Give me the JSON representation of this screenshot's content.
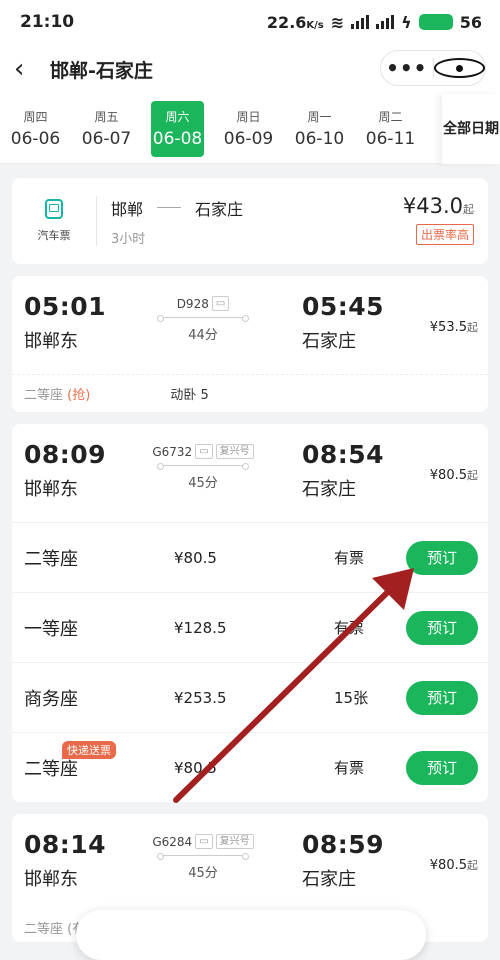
{
  "status": {
    "time": "21:10",
    "speed": "22.6",
    "speed_unit": "K/s",
    "battery": "56"
  },
  "nav": {
    "title": "邯郸-石家庄",
    "back_icon": "chevron-left-icon",
    "more_icon": "more-dots-icon",
    "close_icon": "target-icon"
  },
  "dates": [
    {
      "weekday": "周四",
      "date": "06-06"
    },
    {
      "weekday": "周五",
      "date": "06-07"
    },
    {
      "weekday": "周六",
      "date": "06-08"
    },
    {
      "weekday": "周日",
      "date": "06-09"
    },
    {
      "weekday": "周一",
      "date": "06-10"
    },
    {
      "weekday": "周二",
      "date": "06-11"
    }
  ],
  "all_dates": "全部日期",
  "bus": {
    "type": "汽车票",
    "from": "邯郸",
    "to": "石家庄",
    "duration": "3小时",
    "price": "¥43.0",
    "price_suffix": "起",
    "badge": "出票率高"
  },
  "trains": [
    {
      "dep_time": "05:01",
      "dep_station": "邯郸东",
      "train_no": "D928",
      "duration": "44分",
      "arr_time": "05:45",
      "arr_station": "石家庄",
      "price": "¥53.5",
      "price_suffix": "起",
      "seat_info": "二等座",
      "seat_note": "(抢)",
      "extra": "动卧 5"
    },
    {
      "dep_time": "08:09",
      "dep_station": "邯郸东",
      "train_no": "G6732",
      "tag": "复兴号",
      "duration": "45分",
      "arr_time": "08:54",
      "arr_station": "石家庄",
      "price": "¥80.5",
      "price_suffix": "起",
      "seats": [
        {
          "name": "二等座",
          "price": "¥80.5",
          "stock": "有票",
          "book": "预订"
        },
        {
          "name": "一等座",
          "price": "¥128.5",
          "stock": "有票",
          "book": "预订"
        },
        {
          "name": "商务座",
          "price": "¥253.5",
          "stock": "15张",
          "book": "预订"
        },
        {
          "name": "二等座",
          "price": "¥80.5",
          "stock": "有票",
          "book": "预订",
          "badge": "快递送票"
        }
      ]
    },
    {
      "dep_time": "08:14",
      "dep_station": "邯郸东",
      "train_no": "G6284",
      "tag": "复兴号",
      "duration": "45分",
      "arr_time": "08:59",
      "arr_station": "石家庄",
      "price": "¥80.5",
      "price_suffix": "起",
      "seat_info": "二等座 (有"
    }
  ],
  "colors": {
    "accent": "#1bb55c",
    "orange": "#e86a4a",
    "annotation_arrow": "#a32020"
  }
}
